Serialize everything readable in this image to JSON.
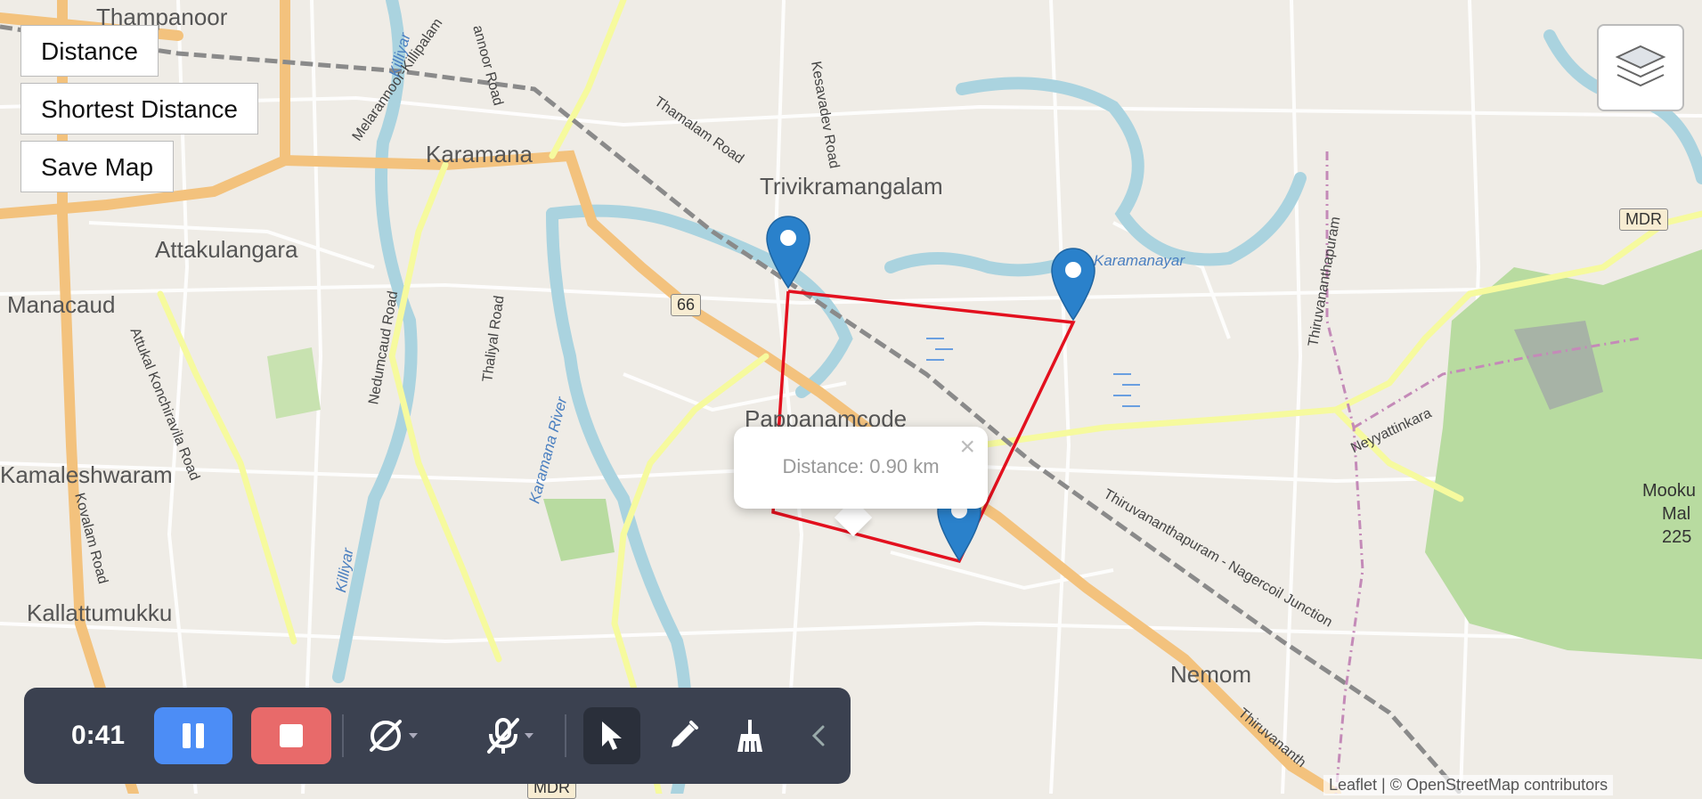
{
  "controls": {
    "distance_label": "Distance",
    "shortest_distance_label": "Shortest Distance",
    "save_map_label": "Save Map"
  },
  "places": {
    "thampanoor": "Thampanoor",
    "karamana": "Karamana",
    "trivikramangalam": "Trivikramangalam",
    "attakulangara": "Attakulangara",
    "manacaud": "Manacaud",
    "pappanamcode": "Pappanamcode",
    "kamaleshwaram": "Kamaleshwaram",
    "kallattumukku": "Kallattumukku",
    "nemom": "Nemom",
    "mookkunnimala": "Mooku",
    "mala": "Mal",
    "elevation": "225"
  },
  "roads": {
    "thamalam_road": "Thamalam Road",
    "kesavadev_road": "Kesavadev Road",
    "nedumcaud_road": "Nedumcaud Road",
    "thaliyal_road": "Thaliyal Road",
    "attukal_road": "Attukal Konchiravila Road",
    "kovalam_road": "Kovalam Road",
    "melarannoor_road": "Melarannoor-Killipalam",
    "annoor_road": "annoor Road",
    "tvm_nagercoil": "Thiruvananthapuram - Nagercoil Junction",
    "thiruvananthapuram_vertical": "Thiruvananthapuram",
    "neyyattinkara": "Neyyattinkara",
    "thiruvananth_bottom": "Thiruvananth",
    "nh66": "66",
    "mdr": "MDR",
    "mdr_bottom": "MDR"
  },
  "water": {
    "karamana_river": "Karamana River",
    "karamanayar": "Karamanayar",
    "killiyar": "Killiyar",
    "killiyar_top": "Killiyar"
  },
  "popup": {
    "distance_text": "Distance: 0.90 km",
    "close_symbol": "×"
  },
  "recorder": {
    "time": "0:41"
  },
  "attribution": "Leaflet | © OpenStreetMap contributors",
  "colors": {
    "route_line": "#e3101e",
    "marker": "#2a81cb",
    "toolbar": "#3b4150",
    "pause": "#4c8df6",
    "stop": "#e86a6a",
    "park": "#b8dba0",
    "river": "#aad3df"
  },
  "icons": {
    "layers": "layers-icon",
    "pause": "pause-icon",
    "stop": "stop-icon",
    "camera_off": "camera-off-icon",
    "mic_off": "mic-off-icon",
    "cursor": "cursor-icon",
    "pen": "pen-icon",
    "broom": "broom-icon",
    "collapse": "chevron-left-icon"
  }
}
